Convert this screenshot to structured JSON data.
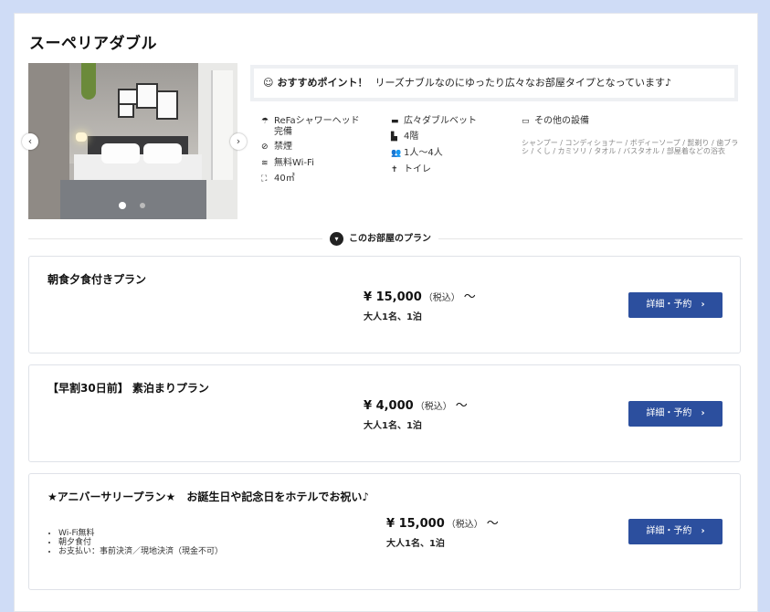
{
  "room": {
    "title": "スーペリアダブル",
    "recommend": {
      "icon": "smile-icon",
      "label": "おすすめポイント！",
      "text": "リーズナブルなのにゆったり広々なお部屋タイプとなっています♪"
    },
    "features_col1": [
      {
        "icon": "shower-icon",
        "lines": [
          "ReFaシャワーヘッド",
          "完備"
        ]
      },
      {
        "icon": "no-smoking-icon",
        "lines": [
          "禁煙"
        ]
      },
      {
        "icon": "wifi-icon",
        "lines": [
          "無料Wi-Fi"
        ]
      },
      {
        "icon": "expand-icon",
        "lines": [
          "40㎡"
        ]
      }
    ],
    "features_col2": [
      {
        "icon": "bed-icon",
        "lines": [
          "広々ダブルベット"
        ]
      },
      {
        "icon": "building-icon",
        "lines": [
          "4階"
        ]
      },
      {
        "icon": "people-icon",
        "lines": [
          "1人〜4人"
        ]
      },
      {
        "icon": "toilet-icon",
        "lines": [
          "トイレ"
        ]
      }
    ],
    "other": {
      "icon": "amenity-icon",
      "label": "その他の設備",
      "desc": "シャンプー / コンディショナー / ボディーソープ / 髭剃り / 歯ブラシ / くし / カミソリ / タオル / バスタオル / 部屋着などの浴衣"
    },
    "carousel": {
      "active_index": 0,
      "count": 2
    }
  },
  "plans_heading": "このお部屋のプラン",
  "plans": [
    {
      "name": "朝食夕食付きプラン",
      "price": "¥ 15,000",
      "tax": "（税込）",
      "tilde": "〜",
      "guests": "大人1名、1泊",
      "button": "詳細・予約",
      "bullets": []
    },
    {
      "name": "【早割30日前】 素泊まりプラン",
      "price": "¥ 4,000",
      "tax": "（税込）",
      "tilde": "〜",
      "guests": "大人1名、1泊",
      "button": "詳細・予約",
      "bullets": []
    },
    {
      "name": "★アニバーサリープラン★　お誕生日や記念日をホテルでお祝い♪",
      "price": "¥ 15,000",
      "tax": "（税込）",
      "tilde": "〜",
      "guests": "大人1名、1泊",
      "button": "詳細・予約",
      "bullets": [
        "Wi-Fi無料",
        "朝夕食付",
        "お支払い：事前決済／現地決済（現金不可）"
      ]
    }
  ],
  "colors": {
    "accent": "#2c4f9e",
    "background": "#cfdcf6"
  }
}
